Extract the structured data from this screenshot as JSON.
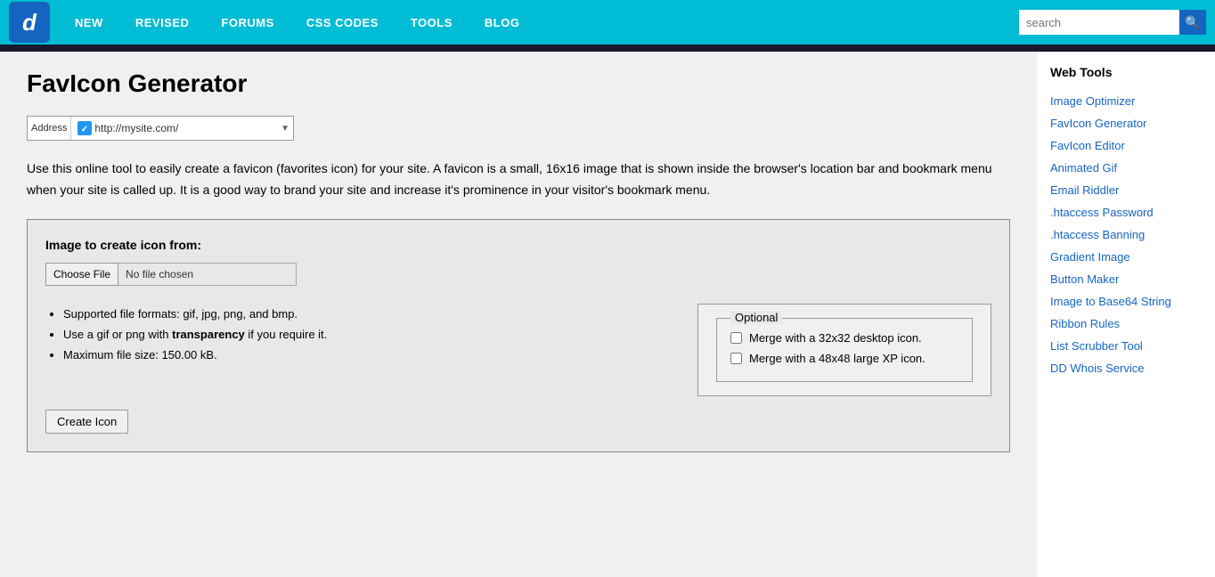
{
  "topbar": {
    "logo_letter": "d",
    "nav": [
      {
        "label": "NEW",
        "id": "nav-new"
      },
      {
        "label": "REVISED",
        "id": "nav-revised"
      },
      {
        "label": "FORUMS",
        "id": "nav-forums"
      },
      {
        "label": "CSS CODES",
        "id": "nav-css"
      },
      {
        "label": "TOOLS",
        "id": "nav-tools"
      },
      {
        "label": "BLOG",
        "id": "nav-blog"
      }
    ],
    "search_placeholder": "search"
  },
  "content": {
    "page_title": "FavIcon Generator",
    "address_label": "Address",
    "address_url": "http://mysite.com/",
    "description": "Use this online tool to easily create a favicon (favorites icon) for your site. A favicon is a small, 16x16 image that is shown inside the browser's location bar and bookmark menu when your site is called up. It is a good way to brand your site and increase it's prominence in your visitor's bookmark menu.",
    "form": {
      "title": "Image to create icon from:",
      "choose_file_label": "Choose File",
      "no_file_label": "No file chosen",
      "bullets": [
        "Supported file formats: gif, jpg, png, and bmp.",
        "Use a gif or png with transparency if you require it.",
        "Maximum file size: 150.00 kB."
      ],
      "optional_legend": "Optional",
      "checkbox1": "Merge with a 32x32 desktop icon.",
      "checkbox2": "Merge with a 48x48 large XP icon.",
      "create_icon_label": "Create Icon"
    }
  },
  "sidebar": {
    "title": "Web Tools",
    "links": [
      "Image Optimizer",
      "FavIcon Generator",
      "FavIcon Editor",
      "Animated Gif",
      "Email Riddler",
      ".htaccess Password",
      ".htaccess Banning",
      "Gradient Image",
      "Button Maker",
      "Image to Base64 String",
      "Ribbon Rules",
      "List Scrubber Tool",
      "DD Whois Service"
    ]
  }
}
